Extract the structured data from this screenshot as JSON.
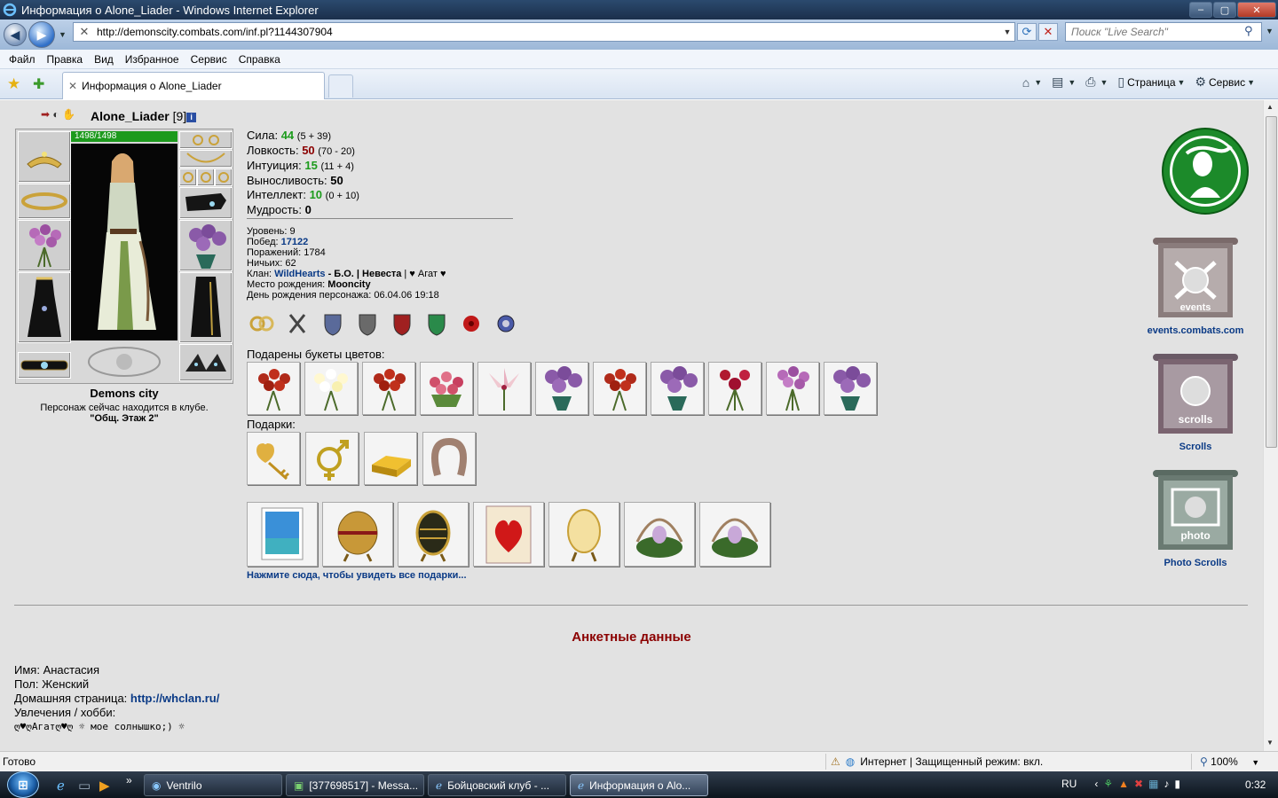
{
  "window": {
    "title": "Информация о Alone_Liader - Windows Internet Explorer",
    "minimize": "‒",
    "maximize": "▢",
    "close": "✕"
  },
  "addressbar": {
    "url": "http://demonscity.combats.com/inf.pl?1144307904",
    "search_placeholder": "Поиск \"Live Search\""
  },
  "menu": {
    "items": [
      "Файл",
      "Правка",
      "Вид",
      "Избранное",
      "Сервис",
      "Справка"
    ]
  },
  "tabs": {
    "active_label": "Информация о Alone_Liader"
  },
  "commandbar": {
    "page_label": "Страница",
    "tools_label": "Сервис"
  },
  "character": {
    "name": "Alone_Liader",
    "level": "[9]",
    "info_icon_text": "i",
    "hp": "1498/1498",
    "hp_fraction": 1.0,
    "city": "Demons city",
    "location_text": "Персонаж сейчас находится в клубе.",
    "room": "\"Общ. Этаж 2\""
  },
  "stats": {
    "strength": {
      "label": "Сила:",
      "value": "44",
      "detail": "(5 + 39)"
    },
    "agility": {
      "label": "Ловкость:",
      "value": "50",
      "detail": "(70 - 20)"
    },
    "intuition": {
      "label": "Интуиция:",
      "value": "15",
      "detail": "(11 + 4)"
    },
    "endurance": {
      "label": "Выносливость:",
      "value": "50"
    },
    "intellect": {
      "label": "Интеллект:",
      "value": "10",
      "detail": "(0 + 10)"
    },
    "wisdom": {
      "label": "Мудрость:",
      "value": "0"
    }
  },
  "info": {
    "level_label": "Уровень:",
    "level_value": "9",
    "wins_label": "Побед:",
    "wins_value": "17122",
    "losses_label": "Поражений:",
    "losses_value": "1784",
    "draws_label": "Ничьих:",
    "draws_value": "62",
    "clan_label": "Клан:",
    "clan_name": "WildHearts",
    "clan_rank": "- Б.О. | Невеста",
    "clan_extra": " | ♥ Агат ♥",
    "birthplace_label": "Место рождения:",
    "birthplace_value": "Mooncity",
    "birthday_label": "День рождения персонажа:",
    "birthday_value": "06.04.06 19:18"
  },
  "sections": {
    "flowers_label": "Подарены букеты цветов:",
    "gifts_label": "Подарки:",
    "all_gifts_link": "Нажмите сюда, чтобы увидеть все подарки..."
  },
  "sidebar": {
    "events_link": "events.combats.com",
    "events_banner": "events",
    "scrolls_link": "Scrolls",
    "scrolls_banner": "scrolls",
    "photo_link": "Photo Scrolls",
    "photo_banner": "photo"
  },
  "anket": {
    "title": "Анкетные данные",
    "name_label": "Имя:",
    "name_value": "Анастасия",
    "sex_label": "Пол:",
    "sex_value": "Женский",
    "homepage_label": "Домашняя страница:",
    "homepage_value": "http://whclan.ru/",
    "hobby_label": "Увлечения / хобби:",
    "hobby_value": "ღ♥ღАгатღ♥ღ  ☼ мое солнышко;) ☼"
  },
  "statusbar": {
    "left": "Готово",
    "zone": "Интернет | Защищенный режим: вкл.",
    "zoom": "100%"
  },
  "taskbar": {
    "tasks": [
      "Ventrilo",
      "[377698517] - Messa...",
      "Бойцовский клуб - ...",
      "Информация о Alo..."
    ],
    "lang": "RU",
    "time": "0:32"
  },
  "colors": {
    "page_bg": "#e2e2e2",
    "link_blue": "#0a3a86",
    "stat_green": "#1c9b1c",
    "stat_red": "#8b0000",
    "hp_green": "#1d9a1d"
  }
}
